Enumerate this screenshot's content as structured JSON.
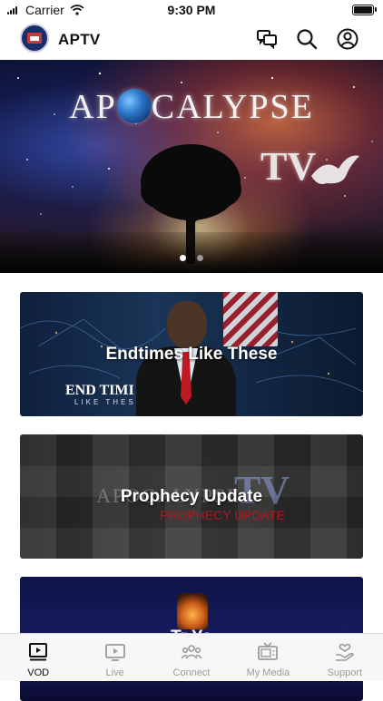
{
  "status_bar": {
    "carrier": "Carrier",
    "time": "9:30 PM"
  },
  "header": {
    "title": "APTV",
    "icons": [
      "chat-icon",
      "search-icon",
      "account-icon"
    ]
  },
  "hero": {
    "title_left": "AP",
    "title_right": "CALYPSE",
    "tv_text": "TV",
    "slides_total": 2,
    "active_slide": 1
  },
  "cards": [
    {
      "title": "Endtimes Like These",
      "overlay_line1": "END TIMI",
      "overlay_line2": "LIKE THES"
    },
    {
      "title": "Prophecy Update",
      "overlay_logo": "APOCALYPSE",
      "overlay_tv": "TV",
      "overlay_sub": "PROPHECY UPDATE"
    },
    {
      "title": "Tr Yo"
    }
  ],
  "tabs": [
    {
      "label": "VOD",
      "icon": "vod-icon",
      "active": true
    },
    {
      "label": "Live",
      "icon": "live-tv-icon",
      "active": false
    },
    {
      "label": "Connect",
      "icon": "people-icon",
      "active": false
    },
    {
      "label": "My Media",
      "icon": "media-icon",
      "active": false
    },
    {
      "label": "Support",
      "icon": "support-icon",
      "active": false
    }
  ],
  "colors": {
    "tab_active": "#111111",
    "tab_inactive": "#9a9a9a",
    "tab_bg": "#f7f7f7"
  }
}
